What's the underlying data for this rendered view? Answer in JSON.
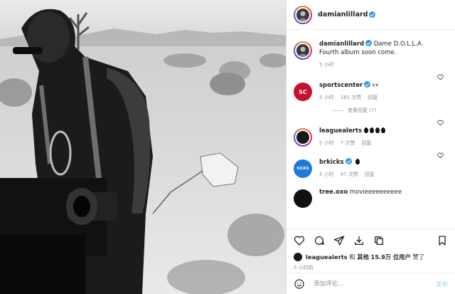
{
  "header": {
    "username": "damianlillard"
  },
  "caption": {
    "username": "damianlillard",
    "text_line1": "Dame D.O.L.L.A.",
    "text_line2": "Fourth album soon come.",
    "time": "5 小时"
  },
  "comments": [
    {
      "username": "sportscenter",
      "text": "👀",
      "time": "5 小时",
      "likes": "181 次赞",
      "reply": "回复",
      "avatar_color": "#c8102e",
      "avatar_text": "SC"
    },
    {
      "username": "leaguealerts",
      "text": "",
      "drops": 4,
      "time": "5 小时",
      "likes": "7 次赞",
      "reply": "回复",
      "avatar_color": "#1a1a1a"
    },
    {
      "username": "brkicks",
      "text": "",
      "drops": 1,
      "time": "5 小时",
      "likes": "47 次赞",
      "reply": "回复",
      "avatar_color": "#1e7ad9",
      "avatar_text": "KICKS"
    },
    {
      "username": "tree.oxo",
      "text": "movieeeeeeeeee"
    }
  ],
  "view_replies": "查看回复 (7)",
  "likes_line": {
    "user": "leaguealerts",
    "conj": "和",
    "others": "其他",
    "count": "15.9万",
    "suffix": "位用户",
    "action": "赞了"
  },
  "post_time": "5 小时前",
  "add_comment": {
    "placeholder": "添加评论...",
    "post_label": "发布"
  },
  "colors": {
    "verified": "#3897f0",
    "meta": "#8e8e8e",
    "post_button": "#b2dffc"
  }
}
